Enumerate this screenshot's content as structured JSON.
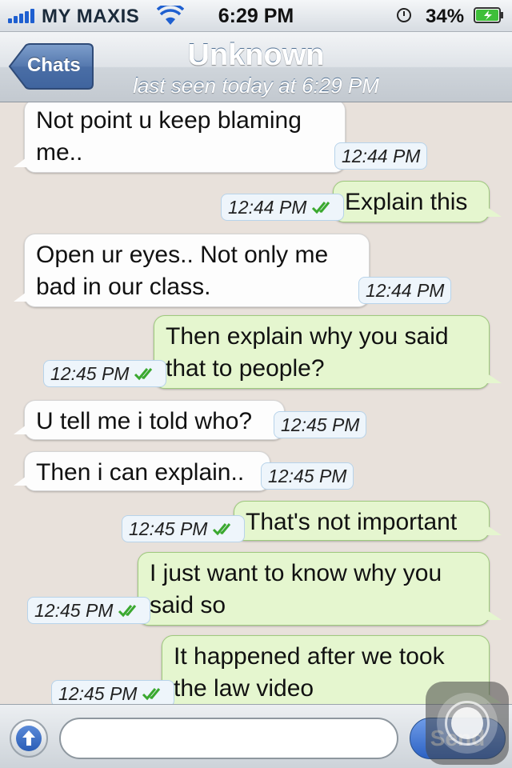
{
  "status_bar": {
    "carrier": "MY MAXIS",
    "time": "6:29 PM",
    "battery": "34%",
    "icons": [
      "signal-icon",
      "wifi-icon",
      "clock-icon",
      "battery-icon"
    ]
  },
  "nav": {
    "back_label": "Chats",
    "title": "Unknown",
    "subtitle": "last seen today at 6:29 PM"
  },
  "messages": [
    {
      "dir": "in",
      "line1": "Not point u keep blaming",
      "line2": "me..",
      "time": "12:44 PM"
    },
    {
      "dir": "out",
      "line1": "Explain this",
      "time": "12:44 PM"
    },
    {
      "dir": "in",
      "line1": "Open ur eyes.. Not only me",
      "line2": "bad in our class.",
      "time": "12:44 PM"
    },
    {
      "dir": "out",
      "line1": "Then explain why you said",
      "line2": "that to people?",
      "time": "12:45 PM"
    },
    {
      "dir": "in",
      "line1": "U tell me i told who?",
      "time": "12:45 PM"
    },
    {
      "dir": "in",
      "line1": "Then i can explain..",
      "time": "12:45 PM"
    },
    {
      "dir": "out",
      "line1": "That's not important",
      "time": "12:45 PM"
    },
    {
      "dir": "out",
      "line1": "I just want to know why you",
      "line2": "said so",
      "time": "12:45 PM"
    },
    {
      "dir": "out",
      "line1": "It happened after we took",
      "line2": "the law video",
      "time": "12:45 PM"
    }
  ],
  "input_bar": {
    "send_label": "Send",
    "input_value": ""
  },
  "colors": {
    "chat_background": "#e8e1db",
    "incoming_bubble": "#fdfdfd",
    "outgoing_bubble": "#e5f6cf",
    "read_tick": "#3aa82f",
    "nav_back_button": "#4a72a8"
  }
}
